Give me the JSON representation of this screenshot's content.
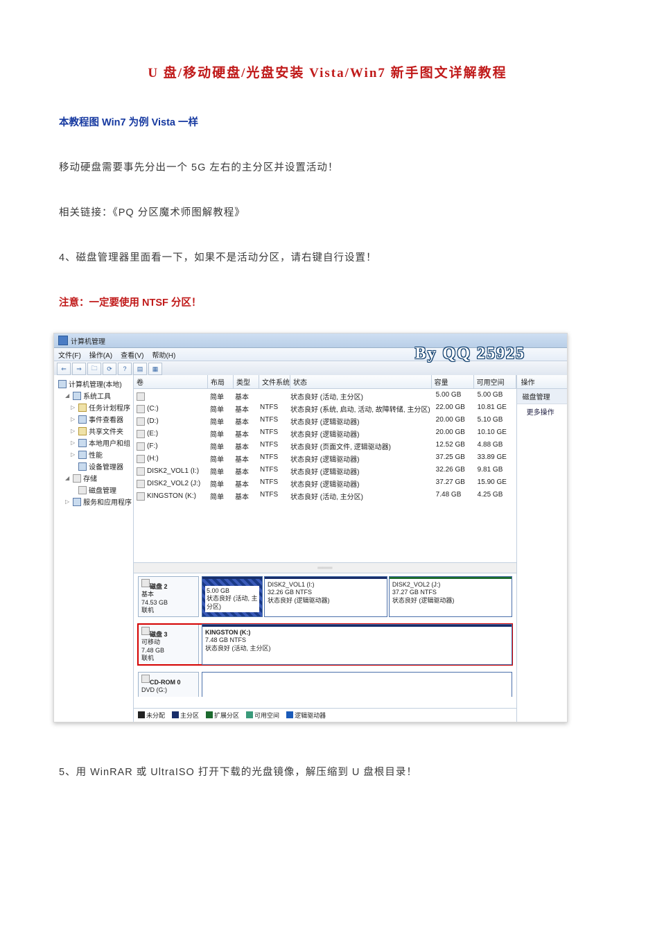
{
  "doc": {
    "title": "U 盘/移动硬盘/光盘安装 Vista/Win7 新手图文详解教程",
    "blue_line": "本教程图 Win7 为例  Vista 一样",
    "p1": "移动硬盘需要事先分出一个 5G 左右的主分区并设置活动！",
    "p2": "相关链接：《PQ 分区魔术师图解教程》",
    "p3": "4、磁盘管理器里面看一下，如果不是活动分区，请右键自行设置！",
    "red_line": "注意：一定要使用 NTSF 分区！",
    "p5": "5、用 WinRAR 或 UltraISO 打开下载的光盘镜像，解压缩到 U 盘根目录！"
  },
  "shot": {
    "window_title": "计算机管理",
    "menus": [
      "文件(F)",
      "操作(A)",
      "查看(V)",
      "帮助(H)"
    ],
    "watermark": "By QQ 25925",
    "tree": {
      "root": "计算机管理(本地)",
      "sys_tools": "系统工具",
      "task_sched": "任务计划程序",
      "event_viewer": "事件查看器",
      "shared_folders": "共享文件夹",
      "local_users": "本地用户和组",
      "perf": "性能",
      "dev_mgr": "设备管理器",
      "storage": "存储",
      "disk_mgmt": "磁盘管理",
      "services": "服务和应用程序"
    },
    "vol_head": {
      "vol": "卷",
      "lay": "布局",
      "typ": "类型",
      "fs": "文件系统",
      "stat": "状态",
      "cap": "容量",
      "free": "可用空间"
    },
    "volumes": [
      {
        "name": "",
        "lay": "简单",
        "typ": "基本",
        "fs": "",
        "stat": "状态良好 (活动, 主分区)",
        "cap": "5.00 GB",
        "free": "5.00 GB"
      },
      {
        "name": "(C:)",
        "lay": "简单",
        "typ": "基本",
        "fs": "NTFS",
        "stat": "状态良好 (系统, 启动, 活动, 故障转储, 主分区)",
        "cap": "22.00 GB",
        "free": "10.81 GE"
      },
      {
        "name": "(D:)",
        "lay": "简单",
        "typ": "基本",
        "fs": "NTFS",
        "stat": "状态良好 (逻辑驱动器)",
        "cap": "20.00 GB",
        "free": "5.10 GB"
      },
      {
        "name": "(E:)",
        "lay": "简单",
        "typ": "基本",
        "fs": "NTFS",
        "stat": "状态良好 (逻辑驱动器)",
        "cap": "20.00 GB",
        "free": "10.10 GE"
      },
      {
        "name": "(F:)",
        "lay": "简单",
        "typ": "基本",
        "fs": "NTFS",
        "stat": "状态良好 (页面文件, 逻辑驱动器)",
        "cap": "12.52 GB",
        "free": "4.88 GB"
      },
      {
        "name": "(H:)",
        "lay": "简单",
        "typ": "基本",
        "fs": "NTFS",
        "stat": "状态良好 (逻辑驱动器)",
        "cap": "37.25 GB",
        "free": "33.89 GE"
      },
      {
        "name": "DISK2_VOL1 (I:)",
        "lay": "简单",
        "typ": "基本",
        "fs": "NTFS",
        "stat": "状态良好 (逻辑驱动器)",
        "cap": "32.26 GB",
        "free": "9.81 GB"
      },
      {
        "name": "DISK2_VOL2 (J:)",
        "lay": "简单",
        "typ": "基本",
        "fs": "NTFS",
        "stat": "状态良好 (逻辑驱动器)",
        "cap": "37.27 GB",
        "free": "15.90 GE"
      },
      {
        "name": "KINGSTON (K:)",
        "lay": "简单",
        "typ": "基本",
        "fs": "NTFS",
        "stat": "状态良好 (活动, 主分区)",
        "cap": "7.48 GB",
        "free": "4.25 GB"
      }
    ],
    "disk2": {
      "label": "磁盘 2",
      "sub1": "基本",
      "sub2": "74.53 GB",
      "sub3": "联机",
      "p1_l1": "5.00 GB",
      "p1_l2": "状态良好 (活动, 主分区)",
      "p2_l1": "DISK2_VOL1 (I:)",
      "p2_l2": "32.26 GB NTFS",
      "p2_l3": "状态良好 (逻辑驱动器)",
      "p3_l1": "DISK2_VOL2 (J:)",
      "p3_l2": "37.27 GB NTFS",
      "p3_l3": "状态良好 (逻辑驱动器)"
    },
    "disk3": {
      "label": "磁盘 3",
      "sub1": "可移动",
      "sub2": "7.48 GB",
      "sub3": "联机",
      "p1_l1": "KINGSTON (K:)",
      "p1_l2": "7.48 GB NTFS",
      "p1_l3": "状态良好 (活动, 主分区)"
    },
    "cdrom": {
      "label": "CD-ROM 0",
      "sub": "DVD (G:)"
    },
    "legend": {
      "unalloc": "未分配",
      "primary": "主分区",
      "ext": "扩展分区",
      "free": "可用空间",
      "logical": "逻辑驱动器"
    },
    "right": {
      "head": "操作",
      "item": "磁盘管理",
      "more": "更多操作"
    }
  }
}
